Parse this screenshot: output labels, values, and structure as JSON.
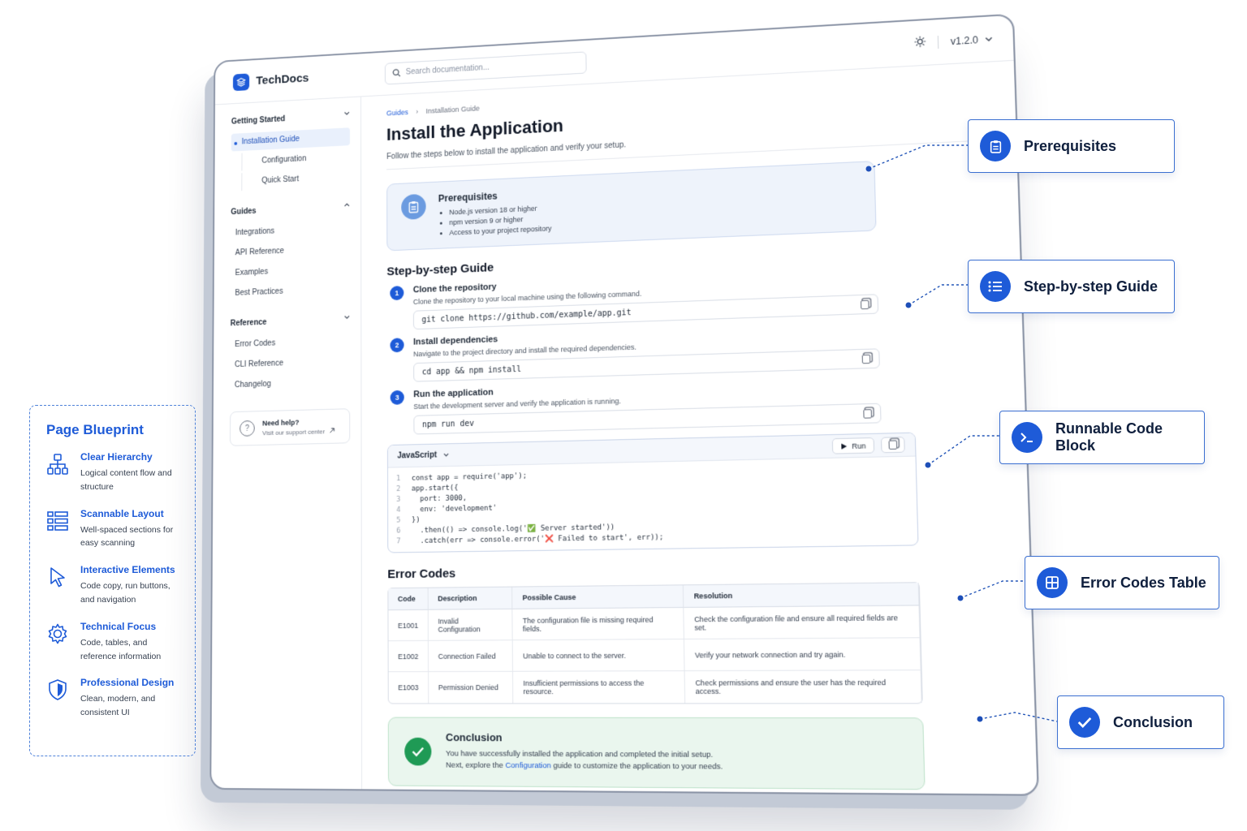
{
  "app": {
    "name": "TechDocs",
    "version": "v1.2.0"
  },
  "search": {
    "placeholder": "Search documentation..."
  },
  "sidebar": {
    "groups": [
      {
        "title": "Getting Started",
        "items": [
          "Installation Guide",
          "Configuration",
          "Quick Start"
        ]
      },
      {
        "title": "Guides",
        "items": [
          "Integrations",
          "API Reference",
          "Examples",
          "Best Practices"
        ]
      },
      {
        "title": "Reference",
        "items": [
          "Error Codes",
          "CLI Reference",
          "Changelog"
        ]
      }
    ],
    "help": {
      "title": "Need help?",
      "subtitle": "Visit our support center"
    }
  },
  "breadcrumb": {
    "parent": "Guides",
    "current": "Installation Guide"
  },
  "page": {
    "title": "Install the Application",
    "subtitle": "Follow the steps below to install the application and verify your setup."
  },
  "prerequisites": {
    "title": "Prerequisites",
    "items": [
      "Node.js version 18 or higher",
      "npm version 9 or higher",
      "Access to your project repository"
    ]
  },
  "steps_section": {
    "title": "Step-by-step Guide",
    "steps": [
      {
        "num": "1",
        "title": "Clone the repository",
        "desc": "Clone the repository to your local machine using the following command.",
        "cmd": "git clone https://github.com/example/app.git"
      },
      {
        "num": "2",
        "title": "Install dependencies",
        "desc": "Navigate to the project directory and install the required dependencies.",
        "cmd": "cd app && npm install"
      },
      {
        "num": "3",
        "title": "Run the application",
        "desc": "Start the development server and verify the application is running.",
        "cmd": "npm run dev"
      }
    ]
  },
  "code_block": {
    "language": "JavaScript",
    "run_label": "Run",
    "lines": [
      {
        "n": "1",
        "t": "const app = require('app');"
      },
      {
        "n": "2",
        "t": "app.start({"
      },
      {
        "n": "3",
        "t": "  port: 3000,"
      },
      {
        "n": "4",
        "t": "  env: 'development'"
      },
      {
        "n": "5",
        "t": "})"
      },
      {
        "n": "6",
        "t": "  .then(() => console.log('✅ Server started'))"
      },
      {
        "n": "7",
        "t": "  .catch(err => console.error('❌ Failed to start', err));"
      }
    ]
  },
  "error_codes": {
    "title": "Error Codes",
    "headers": [
      "Code",
      "Description",
      "Possible Cause",
      "Resolution"
    ],
    "rows": [
      [
        "E1001",
        "Invalid Configuration",
        "The configuration file is missing required fields.",
        "Check the configuration file and ensure all required fields are set."
      ],
      [
        "E1002",
        "Connection Failed",
        "Unable to connect to the server.",
        "Verify your network connection and try again."
      ],
      [
        "E1003",
        "Permission Denied",
        "Insufficient permissions to access the resource.",
        "Check permissions and ensure the user has the required access."
      ]
    ]
  },
  "conclusion": {
    "title": "Conclusion",
    "line1": "You have successfully installed the application and completed the initial setup.",
    "line2_pre": "Next, explore the",
    "line2_link": "Configuration",
    "line2_post": "guide to customize the application to your needs."
  },
  "callouts": [
    "Prerequisites",
    "Step-by-step Guide",
    "Runnable Code Block",
    "Error Codes Table",
    "Conclusion"
  ],
  "blueprint": {
    "title": "Page Blueprint",
    "items": [
      {
        "title": "Clear Hierarchy",
        "desc": "Logical content flow and structure",
        "icon": "hierarchy-icon"
      },
      {
        "title": "Scannable Layout",
        "desc": "Well-spaced sections for easy scanning",
        "icon": "list-layout-icon"
      },
      {
        "title": "Interactive Elements",
        "desc": "Code copy, run buttons, and navigation",
        "icon": "cursor-icon"
      },
      {
        "title": "Technical Focus",
        "desc": "Code, tables, and reference information",
        "icon": "gear-icon"
      },
      {
        "title": "Professional Design",
        "desc": "Clean, modern, and consistent UI",
        "icon": "shield-icon"
      }
    ]
  },
  "colors": {
    "accent": "#1e5bd8",
    "success": "#1f9a55",
    "prereq_bg": "#eef3fb",
    "conclusion_bg": "#eaf6ee"
  }
}
